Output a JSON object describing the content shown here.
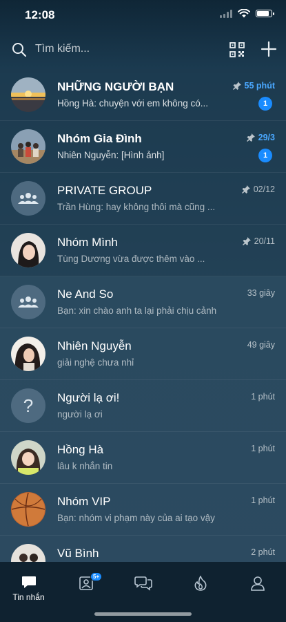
{
  "status_bar": {
    "time": "12:08"
  },
  "search": {
    "placeholder": "Tìm kiếm..."
  },
  "conversations": [
    {
      "name": "NHỮNG NGƯỜI BẠN",
      "preview": "Hồng Hà: chuyện với em không có...",
      "time": "55 phút",
      "pinned": true,
      "unread": "1"
    },
    {
      "name": "Nhóm Gia Đình",
      "preview": "Nhiên Nguyễn: [Hình ảnh]",
      "time": "29/3",
      "pinned": true,
      "unread": "1"
    },
    {
      "name": "PRIVATE GROUP",
      "preview": "Trần Hùng: hay không thôi mà cũng ...",
      "time": "02/12",
      "pinned": true
    },
    {
      "name": "Nhóm Mình",
      "preview": "Tùng Dương vừa được thêm vào ...",
      "time": "20/11",
      "pinned": true
    },
    {
      "name": "Ne And So",
      "preview": "Bạn: xin chào anh ta lại phải chịu cảnh",
      "time": "33 giây"
    },
    {
      "name": "Nhiên Nguyễn",
      "preview": "giải nghệ chưa nhỉ",
      "time": "49 giây"
    },
    {
      "name": "Người lạ ơi!",
      "preview": "người lạ ơi",
      "time": "1 phút",
      "avatar_glyph": "?"
    },
    {
      "name": "Hồng Hà",
      "preview": "lâu k nhắn tin",
      "time": "1 phút"
    },
    {
      "name": "Nhóm VIP",
      "preview": "Bạn: nhóm vi phạm này của ai tạo vậy",
      "time": "1 phút"
    },
    {
      "name": "Vũ Bình",
      "preview": "",
      "time": "2 phút"
    }
  ],
  "tabbar": {
    "messages_label": "Tin nhắn",
    "contacts_badge": "5+"
  },
  "colors": {
    "accent": "#1a8cff",
    "pinned_time": "#4aa8ff"
  }
}
